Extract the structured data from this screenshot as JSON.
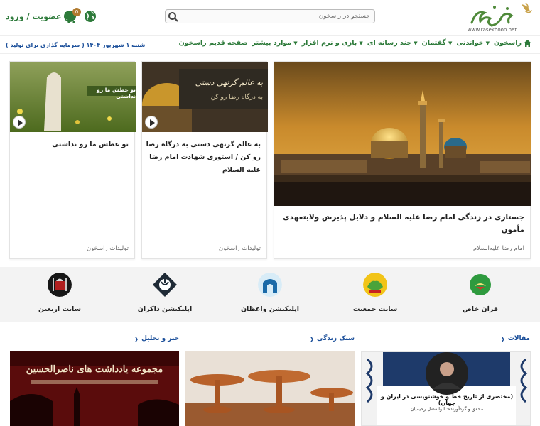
{
  "header": {
    "logo_url": "www.rasekhoon.net",
    "search_placeholder": "جستجو در راسخون",
    "login_label": "عضویت / ورود",
    "cart_count": "0"
  },
  "nav": {
    "home": "راسخون",
    "items": [
      "خواندنی",
      "گفتمان",
      "چند رسانه ای",
      "بازی و نرم افزار",
      "موارد بیشتر",
      "صفحه قدیم راسخون"
    ],
    "date_text": "شنبه ۱ شهریور ۱۴۰۴ ( سرمایه گذاری برای تولید )"
  },
  "cards": {
    "main": {
      "title": "جستاری در زندگی امام رضا علیه السلام و دلایل پذیرش ولایتعهدی مأمون",
      "category": "امام رضا علیه‌السلام"
    },
    "mid": {
      "title": "به عالم گرتهی دستی به درگاه رضا رو کن / استوری شهادت امام رضا علیه السلام",
      "category": "تولیدات راسخون",
      "img_text": "به عالم گرتهی دستی به درگاه رضا رو کن"
    },
    "left": {
      "title": "تو عطش ما رو نداشتی",
      "category": "تولیدات راسخون",
      "img_text": "تو عطش ما رو نداشتی"
    }
  },
  "apps": [
    {
      "label": "قرآن خاص",
      "icon": "quran-icon"
    },
    {
      "label": "سایت جمعیت",
      "icon": "society-icon"
    },
    {
      "label": "اپلیکیشن واعظان",
      "icon": "preachers-icon"
    },
    {
      "label": "اپلیکیشن ذاکران",
      "icon": "zakeran-icon"
    },
    {
      "label": "سایت اربعین",
      "icon": "arbaeen-icon"
    }
  ],
  "sections": {
    "articles": "مقالات",
    "lifestyle": "سبک زندگی",
    "news": "خبر و تحلیل"
  },
  "bottom": {
    "article_caption": "(مختصری از تاریخ خط و خوشنویسی در ایران و جهان)",
    "article_sub": "محقق و گردآورنده: ابوالفضل رحیمیان",
    "news_banner": "مجموعه یادداشت های ناصرالحسین"
  },
  "colors": {
    "brand_green": "#2d7a3a",
    "link_blue": "#1b4f9a",
    "badge": "#b07a2f"
  }
}
